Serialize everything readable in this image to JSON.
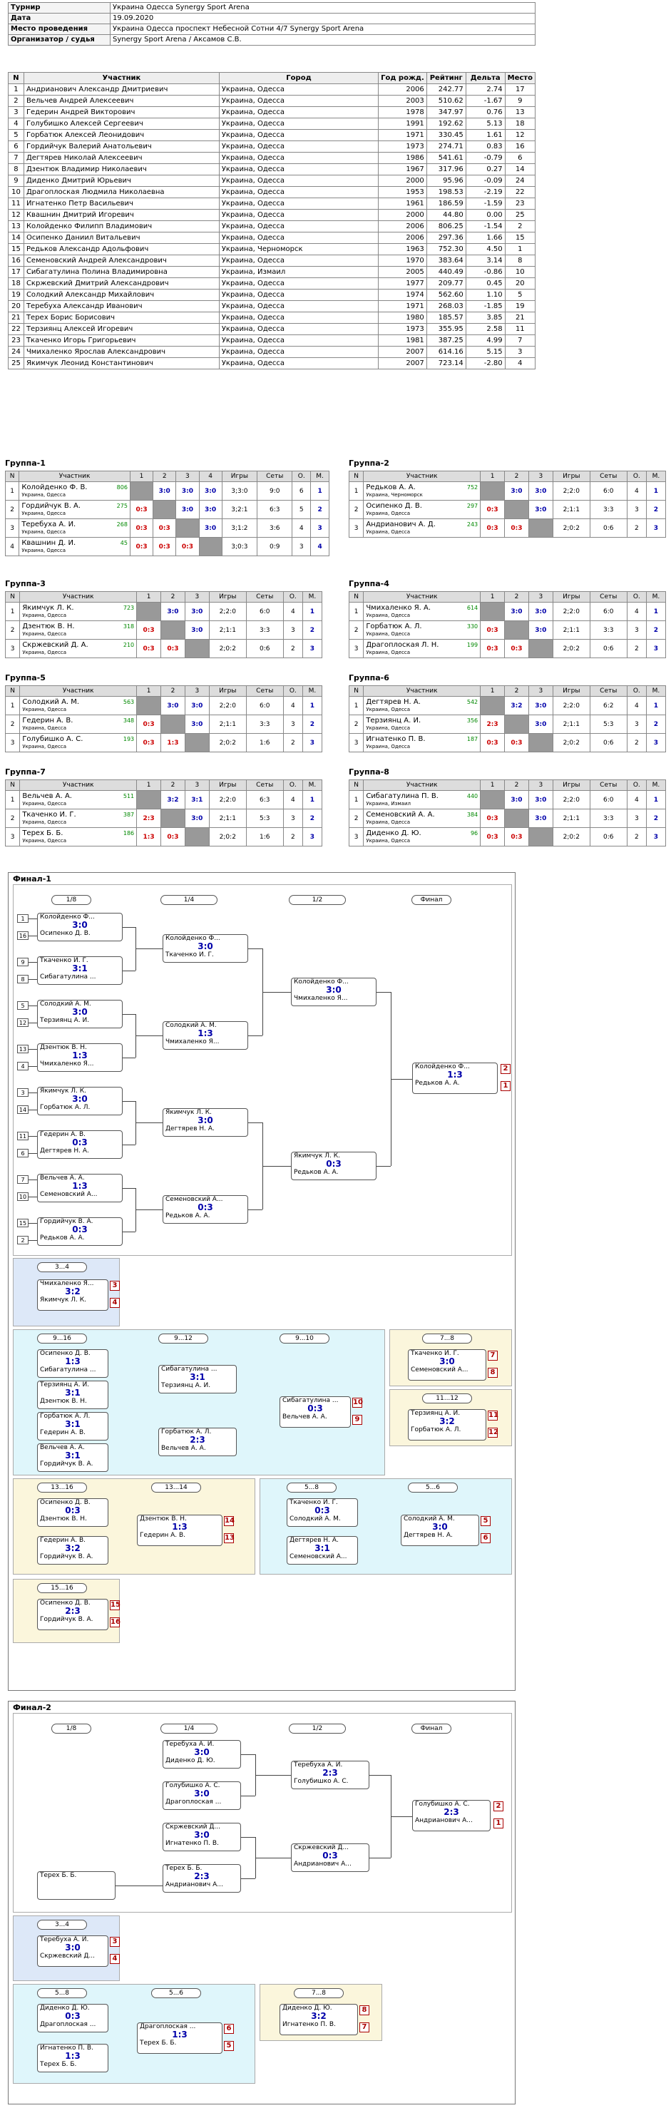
{
  "info": [
    [
      "Турнир",
      "Украина Одесса Synergy Sport Arena"
    ],
    [
      "Дата",
      "19.09.2020"
    ],
    [
      "Место проведения",
      "Украина Одесса проспект Небесной Сотни 4/7 Synergy Sport Arena"
    ],
    [
      "Организатор / судья",
      "Synergy Sport Arena / Аксамов С.В."
    ]
  ],
  "plist_head": [
    "N",
    "Участник",
    "Город",
    "Год рожд.",
    "Рейтинг",
    "Дельта",
    "Место"
  ],
  "players": [
    [
      "1",
      "Андрианович Александр Дмитриевич",
      "Украина, Одесса",
      "2006",
      "242.77",
      "2.74",
      "17"
    ],
    [
      "2",
      "Вельчев Андрей Алексеевич",
      "Украина, Одесса",
      "2003",
      "510.62",
      "-1.67",
      "9"
    ],
    [
      "3",
      "Гедерин Андрей Викторович",
      "Украина, Одесса",
      "1978",
      "347.97",
      "0.76",
      "13"
    ],
    [
      "4",
      "Голубишко Алексей Сергеевич",
      "Украина, Одесса",
      "1991",
      "192.62",
      "5.13",
      "18"
    ],
    [
      "5",
      "Горбатюк Алексей Леонидович",
      "Украина, Одесса",
      "1971",
      "330.45",
      "1.61",
      "12"
    ],
    [
      "6",
      "Гордийчук Валерий Анатольевич",
      "Украина, Одесса",
      "1973",
      "274.71",
      "0.83",
      "16"
    ],
    [
      "7",
      "Дегтярев Николай Алексеевич",
      "Украина, Одесса",
      "1986",
      "541.61",
      "-0.79",
      "6"
    ],
    [
      "8",
      "Дзентюк Владимир Николаевич",
      "Украина, Одесса",
      "1967",
      "317.96",
      "0.27",
      "14"
    ],
    [
      "9",
      "Диденко Дмитрий Юрьевич",
      "Украина, Одесса",
      "2000",
      "95.96",
      "-0.09",
      "24"
    ],
    [
      "10",
      "Драгоплоская Людмила Николаевна",
      "Украина, Одесса",
      "1953",
      "198.53",
      "-2.19",
      "22"
    ],
    [
      "11",
      "Игнатенко Петр Васильевич",
      "Украина, Одесса",
      "1961",
      "186.59",
      "-1.59",
      "23"
    ],
    [
      "12",
      "Квашнин Дмитрий Игоревич",
      "Украина, Одесса",
      "2000",
      "44.80",
      "0.00",
      "25"
    ],
    [
      "13",
      "Колойденко Филипп Владимович",
      "Украина, Одесса",
      "2006",
      "806.25",
      "-1.54",
      "2"
    ],
    [
      "14",
      "Осипенко Даниил Витальевич",
      "Украина, Одесса",
      "2006",
      "297.36",
      "1.66",
      "15"
    ],
    [
      "15",
      "Редьков Александр Адольфович",
      "Украина, Черноморск",
      "1963",
      "752.30",
      "4.50",
      "1"
    ],
    [
      "16",
      "Семеновский Андрей Александрович",
      "Украина, Одесса",
      "1970",
      "383.64",
      "3.14",
      "8"
    ],
    [
      "17",
      "Сибагатулина Полина Владимировна",
      "Украина, Измаил",
      "2005",
      "440.49",
      "-0.86",
      "10"
    ],
    [
      "18",
      "Скржевский Дмитрий Александрович",
      "Украина, Одесса",
      "1977",
      "209.77",
      "0.45",
      "20"
    ],
    [
      "19",
      "Солодкий Александр Михайлович",
      "Украина, Одесса",
      "1974",
      "562.60",
      "1.10",
      "5"
    ],
    [
      "20",
      "Теребуха Александр Иванович",
      "Украина, Одесса",
      "1971",
      "268.03",
      "-1.85",
      "19"
    ],
    [
      "21",
      "Терех Борис Борисович",
      "Украина, Одесса",
      "1980",
      "185.57",
      "3.85",
      "21"
    ],
    [
      "22",
      "Терзиянц Алексей Игоревич",
      "Украина, Одесса",
      "1973",
      "355.95",
      "2.58",
      "11"
    ],
    [
      "23",
      "Ткаченко Игорь Григорьевич",
      "Украина, Одесса",
      "1981",
      "387.25",
      "4.99",
      "7"
    ],
    [
      "24",
      "Чмихаленко Ярослав Александрович",
      "Украина, Одесса",
      "2007",
      "614.16",
      "5.15",
      "3"
    ],
    [
      "25",
      "Якимчук Леонид Константинович",
      "Украина, Одесса",
      "2007",
      "723.14",
      "-2.80",
      "4"
    ]
  ],
  "groups": [
    {
      "title": "Группа-1",
      "cols": [
        "N",
        "Участник",
        "1",
        "2",
        "3",
        "4",
        "Игры",
        "Сеты",
        "О.",
        "М."
      ],
      "rows": [
        {
          "n": "1",
          "name": "Колойденко Ф. В.",
          "city": "Украина, Одесса",
          "r": "806",
          "sc": [
            "",
            "3:0",
            "3:0",
            "3:0"
          ],
          "g": "3;3:0",
          "s": "9:0",
          "o": "6",
          "m": "1"
        },
        {
          "n": "2",
          "name": "Гордийчук В. А.",
          "city": "Украина, Одесса",
          "r": "275",
          "sc": [
            "0:3",
            "",
            "3:0",
            "3:0"
          ],
          "g": "3;2:1",
          "s": "6:3",
          "o": "5",
          "m": "2"
        },
        {
          "n": "3",
          "name": "Теребуха А. И.",
          "city": "Украина, Одесса",
          "r": "268",
          "sc": [
            "0:3",
            "0:3",
            "",
            "3:0"
          ],
          "g": "3;1:2",
          "s": "3:6",
          "o": "4",
          "m": "3"
        },
        {
          "n": "4",
          "name": "Квашнин Д. И.",
          "city": "Украина, Одесса",
          "r": "45",
          "sc": [
            "0:3",
            "0:3",
            "0:3",
            ""
          ],
          "g": "3;0:3",
          "s": "0:9",
          "o": "3",
          "m": "4"
        }
      ]
    },
    {
      "title": "Группа-2",
      "cols": [
        "N",
        "Участник",
        "1",
        "2",
        "3",
        "Игры",
        "Сеты",
        "О.",
        "М."
      ],
      "rows": [
        {
          "n": "1",
          "name": "Редьков А. А.",
          "city": "Украина, Черноморск",
          "r": "752",
          "sc": [
            "",
            "3:0",
            "3:0"
          ],
          "g": "2;2:0",
          "s": "6:0",
          "o": "4",
          "m": "1"
        },
        {
          "n": "2",
          "name": "Осипенко Д. В.",
          "city": "Украина, Одесса",
          "r": "297",
          "sc": [
            "0:3",
            "",
            "3:0"
          ],
          "g": "2;1:1",
          "s": "3:3",
          "o": "3",
          "m": "2"
        },
        {
          "n": "3",
          "name": "Андрианович А. Д.",
          "city": "Украина, Одесса",
          "r": "243",
          "sc": [
            "0:3",
            "0:3",
            ""
          ],
          "g": "2;0:2",
          "s": "0:6",
          "o": "2",
          "m": "3"
        }
      ]
    },
    {
      "title": "Группа-3",
      "cols": [
        "N",
        "Участник",
        "1",
        "2",
        "3",
        "Игры",
        "Сеты",
        "О.",
        "М."
      ],
      "rows": [
        {
          "n": "1",
          "name": "Якимчук Л. К.",
          "city": "Украина, Одесса",
          "r": "723",
          "sc": [
            "",
            "3:0",
            "3:0"
          ],
          "g": "2;2:0",
          "s": "6:0",
          "o": "4",
          "m": "1"
        },
        {
          "n": "2",
          "name": "Дзентюк В. Н.",
          "city": "Украина, Одесса",
          "r": "318",
          "sc": [
            "0:3",
            "",
            "3:0"
          ],
          "g": "2;1:1",
          "s": "3:3",
          "o": "3",
          "m": "2"
        },
        {
          "n": "3",
          "name": "Скржевский Д. А.",
          "city": "Украина, Одесса",
          "r": "210",
          "sc": [
            "0:3",
            "0:3",
            ""
          ],
          "g": "2;0:2",
          "s": "0:6",
          "o": "2",
          "m": "3"
        }
      ]
    },
    {
      "title": "Группа-4",
      "cols": [
        "N",
        "Участник",
        "1",
        "2",
        "3",
        "Игры",
        "Сеты",
        "О.",
        "М."
      ],
      "rows": [
        {
          "n": "1",
          "name": "Чмихаленко Я. А.",
          "city": "Украина, Одесса",
          "r": "614",
          "sc": [
            "",
            "3:0",
            "3:0"
          ],
          "g": "2;2:0",
          "s": "6:0",
          "o": "4",
          "m": "1"
        },
        {
          "n": "2",
          "name": "Горбатюк А. Л.",
          "city": "Украина, Одесса",
          "r": "330",
          "sc": [
            "0:3",
            "",
            "3:0"
          ],
          "g": "2;1:1",
          "s": "3:3",
          "o": "3",
          "m": "2"
        },
        {
          "n": "3",
          "name": "Драгоплоская Л. Н.",
          "city": "Украина, Одесса",
          "r": "199",
          "sc": [
            "0:3",
            "0:3",
            ""
          ],
          "g": "2;0:2",
          "s": "0:6",
          "o": "2",
          "m": "3"
        }
      ]
    },
    {
      "title": "Группа-5",
      "cols": [
        "N",
        "Участник",
        "1",
        "2",
        "3",
        "Игры",
        "Сеты",
        "О.",
        "М."
      ],
      "rows": [
        {
          "n": "1",
          "name": "Солодкий А. М.",
          "city": "Украина, Одесса",
          "r": "563",
          "sc": [
            "",
            "3:0",
            "3:0"
          ],
          "g": "2;2:0",
          "s": "6:0",
          "o": "4",
          "m": "1"
        },
        {
          "n": "2",
          "name": "Гедерин А. В.",
          "city": "Украина, Одесса",
          "r": "348",
          "sc": [
            "0:3",
            "",
            "3:0"
          ],
          "g": "2;1:1",
          "s": "3:3",
          "o": "3",
          "m": "2"
        },
        {
          "n": "3",
          "name": "Голубишко А. С.",
          "city": "Украина, Одесса",
          "r": "193",
          "sc": [
            "0:3",
            "1:3",
            ""
          ],
          "g": "2;0:2",
          "s": "1:6",
          "o": "2",
          "m": "3"
        }
      ]
    },
    {
      "title": "Группа-6",
      "cols": [
        "N",
        "Участник",
        "1",
        "2",
        "3",
        "Игры",
        "Сеты",
        "О.",
        "М."
      ],
      "rows": [
        {
          "n": "1",
          "name": "Дегтярев Н. А.",
          "city": "Украина, Одесса",
          "r": "542",
          "sc": [
            "",
            "3:2",
            "3:0"
          ],
          "g": "2;2:0",
          "s": "6:2",
          "o": "4",
          "m": "1"
        },
        {
          "n": "2",
          "name": "Терзиянц А. И.",
          "city": "Украина, Одесса",
          "r": "356",
          "sc": [
            "2:3",
            "",
            "3:0"
          ],
          "g": "2;1:1",
          "s": "5:3",
          "o": "3",
          "m": "2"
        },
        {
          "n": "3",
          "name": "Игнатенко П. В.",
          "city": "Украина, Одесса",
          "r": "187",
          "sc": [
            "0:3",
            "0:3",
            ""
          ],
          "g": "2;0:2",
          "s": "0:6",
          "o": "2",
          "m": "3"
        }
      ]
    },
    {
      "title": "Группа-7",
      "cols": [
        "N",
        "Участник",
        "1",
        "2",
        "3",
        "Игры",
        "Сеты",
        "О.",
        "М."
      ],
      "rows": [
        {
          "n": "1",
          "name": "Вельчев А. А.",
          "city": "Украина, Одесса",
          "r": "511",
          "sc": [
            "",
            "3:2",
            "3:1"
          ],
          "g": "2;2:0",
          "s": "6:3",
          "o": "4",
          "m": "1"
        },
        {
          "n": "2",
          "name": "Ткаченко И. Г.",
          "city": "Украина, Одесса",
          "r": "387",
          "sc": [
            "2:3",
            "",
            "3:0"
          ],
          "g": "2;1:1",
          "s": "5:3",
          "o": "3",
          "m": "2"
        },
        {
          "n": "3",
          "name": "Терех Б. Б.",
          "city": "Украина, Одесса",
          "r": "186",
          "sc": [
            "1:3",
            "0:3",
            ""
          ],
          "g": "2;0:2",
          "s": "1:6",
          "o": "2",
          "m": "3"
        }
      ]
    },
    {
      "title": "Группа-8",
      "cols": [
        "N",
        "Участник",
        "1",
        "2",
        "3",
        "Игры",
        "Сеты",
        "О.",
        "М."
      ],
      "rows": [
        {
          "n": "1",
          "name": "Сибагатулина П. В.",
          "city": "Украина, Измаил",
          "r": "440",
          "sc": [
            "",
            "3:0",
            "3:0"
          ],
          "g": "2;2:0",
          "s": "6:0",
          "o": "4",
          "m": "1"
        },
        {
          "n": "2",
          "name": "Семеновский А. А.",
          "city": "Украина, Одесса",
          "r": "384",
          "sc": [
            "0:3",
            "",
            "3:0"
          ],
          "g": "2;1:1",
          "s": "3:3",
          "o": "3",
          "m": "2"
        },
        {
          "n": "3",
          "name": "Диденко Д. Ю.",
          "city": "Украина, Одесса",
          "r": "96",
          "sc": [
            "0:3",
            "0:3",
            ""
          ],
          "g": "2;0:2",
          "s": "0:6",
          "o": "2",
          "m": "3"
        }
      ]
    }
  ],
  "final1": {
    "title": "Финал-1",
    "rounds": [
      "1/8",
      "1/4",
      "1/2",
      "Финал"
    ],
    "seeds": [
      "1",
      "16",
      "9",
      "8",
      "5",
      "12",
      "13",
      "4",
      "3",
      "14",
      "11",
      "6",
      "7",
      "10",
      "15",
      "2"
    ],
    "r8": [
      {
        "a": "Колойденко Ф...",
        "b": "Осипенко Д. В.",
        "s": "3:0",
        "n": "-21"
      },
      {
        "a": "Ткаченко И. Г.",
        "b": "Сибагатулина ...",
        "s": "3:1",
        "n": "-19"
      },
      {
        "a": "Солодкий А. М.",
        "b": "Терзиянц А. И.",
        "s": "3:0",
        "n": "-22"
      },
      {
        "a": "Дзентюк В. Н.",
        "b": "Чмихаленко Я...",
        "s": "1:3",
        "n": "-20"
      },
      {
        "a": "Якимчук Л. К.",
        "b": "Горбатюк А. Л.",
        "s": "3:0",
        "n": "-23"
      },
      {
        "a": "Гедерин А. В.",
        "b": "Дегтярев Н. А.",
        "s": "0:3",
        "n": "-24"
      },
      {
        "a": "Вельчев А. А.",
        "b": "Семеновский А...",
        "s": "1:3",
        "n": "-18"
      },
      {
        "a": "Гордийчук В. А.",
        "b": "Редьков А. А.",
        "s": "0:3",
        "n": "-17"
      }
    ],
    "r4": [
      {
        "a": "Колойденко Ф...",
        "b": "Ткаченко И. Г.",
        "s": "3:0",
        "n": "9"
      },
      {
        "a": "Солодкий А. М.",
        "b": "Чмихаленко Я...",
        "s": "1:3",
        "n": "10"
      },
      {
        "a": "Якимчук Л. К.",
        "b": "Дегтярев Н. А.",
        "s": "3:0",
        "n": "11"
      },
      {
        "a": "Семеновский А...",
        "b": "Редьков А. А.",
        "s": "0:3",
        "n": "12"
      }
    ],
    "r2": [
      {
        "a": "Колойденко Ф...",
        "b": "Чмихаленко Я...",
        "s": "3:0",
        "n": "13"
      },
      {
        "a": "Якимчук Л. К.",
        "b": "Редьков А. А.",
        "s": "0:3",
        "n": "14"
      }
    ],
    "fin": {
      "a": "Колойденко Ф...",
      "b": "Редьков А. А.",
      "s": "1:3",
      "n": "15",
      "pa": "2",
      "pb": "1"
    },
    "third": {
      "title": "3...4",
      "a": "Чмихаленко Я...",
      "b": "Якимчук Л. К.",
      "s": "3:2",
      "n": "16",
      "pa": "3",
      "pb": "4"
    },
    "r9": {
      "t1": "9...16",
      "t2": "9...12",
      "t3": "9...10"
    },
    "r9m": [
      {
        "a": "Осипенко Д. В.",
        "b": "Сибагатулина ...",
        "s": "1:3"
      },
      {
        "a": "Терзиянц А. И.",
        "b": "Дзентюк В. Н.",
        "s": "3:1"
      },
      {
        "a": "Горбатюк А. Л.",
        "b": "Гедерин А. В.",
        "s": "3:1"
      },
      {
        "a": "Вельчев А. А.",
        "b": "Гордийчук В. А.",
        "s": "3:1"
      },
      {
        "a": "Сибагатулина ...",
        "b": "Терзиянц А. И.",
        "s": "3:1"
      },
      {
        "a": "Горбатюк А. Л.",
        "b": "Вельчев А. А.",
        "s": "2:3"
      },
      {
        "a": "Сибагатулина ...",
        "b": "Вельчев А. А.",
        "s": "0:3",
        "pa": "10",
        "pb": "9"
      }
    ],
    "r7": {
      "title": "7...8",
      "a": "Ткаченко И. Г.",
      "b": "Семеновский А...",
      "s": "3:0",
      "pa": "7",
      "pb": "8"
    },
    "r11": {
      "title": "11...12",
      "a": "Терзиянц А. И.",
      "b": "Горбатюк А. Л.",
      "s": "3:2",
      "pa": "11",
      "pb": "12"
    },
    "r13": {
      "t1": "13...16",
      "t2": "13...14",
      "m1a": "Осипенко Д. В.",
      "m1b": "Дзентюк В. Н.",
      "m1s": "0:3",
      "m2a": "Гедерин А. В.",
      "m2b": "Гордийчук В. А.",
      "m2s": "3:2",
      "fa": "Дзентюк В. Н.",
      "fb": "Гедерин А. В.",
      "fs": "1:3",
      "pa": "14",
      "pb": "13"
    },
    "r5": {
      "t1": "5...8",
      "t2": "5...6",
      "m1a": "Ткаченко И. Г.",
      "m1b": "Солодкий А. М.",
      "m1s": "0:3",
      "m2a": "Дегтярев Н. А.",
      "m2b": "Семеновский А...",
      "m2s": "3:1",
      "fa": "Солодкий А. М.",
      "fb": "Дегтярев Н. А.",
      "fs": "3:0",
      "pa": "5",
      "pb": "6"
    },
    "r15": {
      "title": "15...16",
      "a": "Осипенко Д. В.",
      "b": "Гордийчук В. А.",
      "s": "2:3",
      "pa": "15",
      "pb": "16"
    }
  },
  "final2": {
    "title": "Финал-2",
    "rounds": [
      "1/8",
      "1/4",
      "1/2",
      "Финал"
    ],
    "r4": [
      {
        "a": "Теребуха А. И.",
        "b": "Диденко Д. Ю.",
        "s": "3:0"
      },
      {
        "a": "Голубишко А. С.",
        "b": "Драгоплоская ...",
        "s": "3:0"
      },
      {
        "a": "Скржевский Д...",
        "b": "Игнатенко П. В.",
        "s": "3:0"
      },
      {
        "a": "Терех Б. Б.",
        "b": "Андрианович А...",
        "s": "2:3"
      }
    ],
    "r8": {
      "a": "Терех Б. Б.",
      "b": "",
      "s": ""
    },
    "r2": [
      {
        "a": "Теребуха А. И.",
        "b": "Голубишко А. С.",
        "s": "2:3"
      },
      {
        "a": "Скржевский Д...",
        "b": "Андрианович А...",
        "s": "0:3"
      }
    ],
    "fin": {
      "a": "Голубишко А. С.",
      "b": "Андрианович А...",
      "s": "2:3",
      "pa": "2",
      "pb": "1"
    },
    "third": {
      "title": "3...4",
      "a": "Теребуха А. И.",
      "b": "Скржевский Д...",
      "s": "3:0",
      "pa": "3",
      "pb": "4"
    },
    "r5": {
      "t1": "5...8",
      "t2": "5...6",
      "m1a": "Диденко Д. Ю.",
      "m1b": "Драгоплоская ...",
      "m1s": "0:3",
      "m2a": "Игнатенко П. В.",
      "m2b": "Терех Б. Б.",
      "m2s": "1:3",
      "fa": "Драгоплоская ...",
      "fb": "Терех Б. Б.",
      "fs": "1:3",
      "pa": "6",
      "pb": "5"
    },
    "r7": {
      "title": "7...8",
      "a": "Диденко Д. Ю.",
      "b": "Игнатенко П. В.",
      "s": "3:2",
      "pa": "8",
      "pb": "7"
    }
  }
}
